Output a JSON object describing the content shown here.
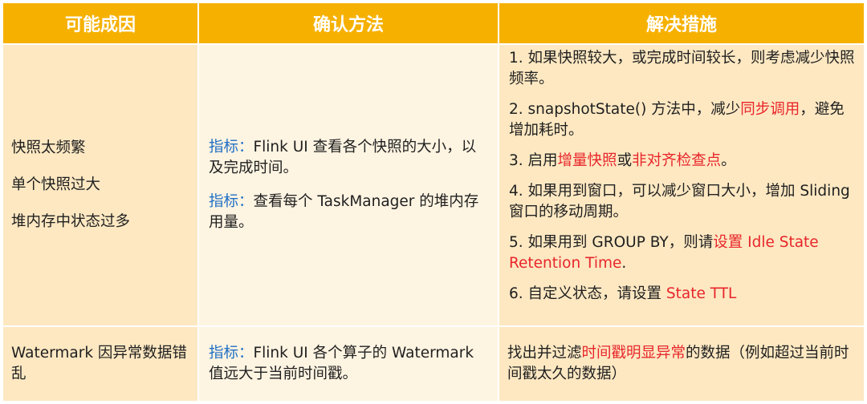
{
  "headers": {
    "cause": "可能成因",
    "method": "确认方法",
    "solution": "解决措施"
  },
  "row1": {
    "causes": [
      "快照太频繁",
      "单个快照过大",
      "堆内存中状态过多"
    ],
    "methods": [
      {
        "label": "指标：",
        "text": "Flink UI 查看各个快照的大小，以及完成时间。"
      },
      {
        "label": "指标：",
        "text": "查看每个 TaskManager 的堆内存用量。"
      }
    ],
    "solutions": [
      {
        "pre": "1. 如果快照较大，或完成时间较长，则考虑减少快照频率。"
      },
      {
        "pre": "2. snapshotState() 方法中，减少",
        "red1": "同步调用",
        "mid": "，避免增加耗时。"
      },
      {
        "pre": "3. 启用",
        "red1": "增量快照",
        "mid": "或",
        "red2": "非对齐检查点",
        "post": "。"
      },
      {
        "pre": "4. 如果用到窗口，可以减少窗口大小，增加 Sliding 窗口的移动周期。"
      },
      {
        "pre": "5. 如果用到 GROUP BY，则请",
        "red1": "设置 Idle State Retention Time",
        "mid": "."
      },
      {
        "pre": "6. 自定义状态，请设置 ",
        "red1": "State TTL"
      }
    ]
  },
  "row2": {
    "cause": "Watermark 因异常数据错乱",
    "method_label": "指标：",
    "method_text": "Flink UI 各个算子的 Watermark 值远大于当前时间戳。",
    "solution_pre": "找出并过滤",
    "solution_red": "时间戳明显异常",
    "solution_post": "的数据（例如超过当前时间戳太久的数据）"
  },
  "colors": {
    "header": "#f6b100",
    "col1": "#fde8c2",
    "col2": "#fef4e2",
    "highlight_red": "#e8262b",
    "highlight_blue": "#1f6fc5"
  }
}
